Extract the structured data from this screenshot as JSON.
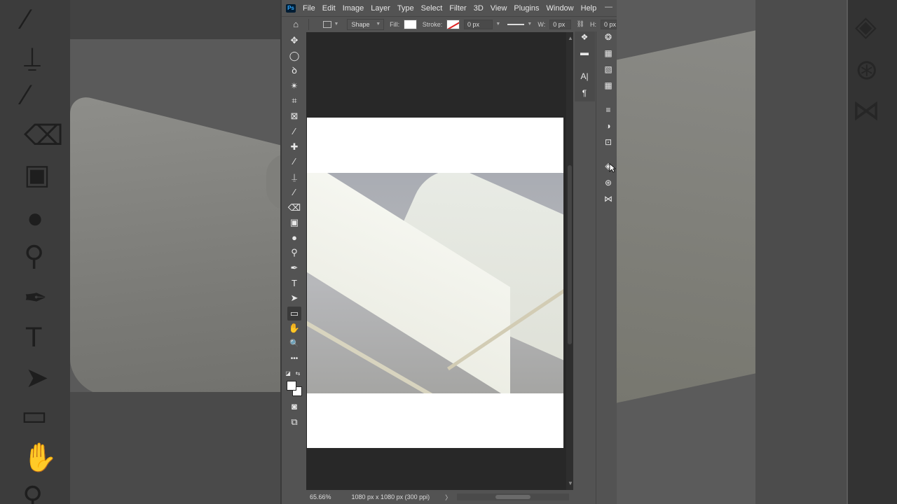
{
  "menubar": {
    "logo": "Ps",
    "items": [
      "File",
      "Edit",
      "Image",
      "Layer",
      "Type",
      "Select",
      "Filter",
      "3D",
      "View",
      "Plugins",
      "Window",
      "Help"
    ]
  },
  "options": {
    "mode": "Shape",
    "fill_label": "Fill:",
    "stroke_label": "Stroke:",
    "stroke_width": "0 px",
    "w_label": "W:",
    "w_value": "0 px",
    "h_label": "H:",
    "h_value": "0 px",
    "fill_color": "#ffffff"
  },
  "tools": [
    {
      "name": "move-tool",
      "glyph": "✥"
    },
    {
      "name": "elliptical-marquee-tool",
      "glyph": "◯"
    },
    {
      "name": "lasso-tool",
      "glyph": "ꝺ"
    },
    {
      "name": "magic-wand-tool",
      "glyph": "✴"
    },
    {
      "name": "crop-tool",
      "glyph": "⌗"
    },
    {
      "name": "frame-tool",
      "glyph": "⊠"
    },
    {
      "name": "eyedropper-tool",
      "glyph": "⁄"
    },
    {
      "name": "healing-brush-tool",
      "glyph": "✚"
    },
    {
      "name": "brush-tool",
      "glyph": "⁄"
    },
    {
      "name": "clone-stamp-tool",
      "glyph": "⍊"
    },
    {
      "name": "history-brush-tool",
      "glyph": "⁄"
    },
    {
      "name": "eraser-tool",
      "glyph": "⌫"
    },
    {
      "name": "gradient-tool",
      "glyph": "▣"
    },
    {
      "name": "blur-tool",
      "glyph": "●"
    },
    {
      "name": "dodge-tool",
      "glyph": "⚲"
    },
    {
      "name": "pen-tool",
      "glyph": "✒"
    },
    {
      "name": "type-tool",
      "glyph": "T"
    },
    {
      "name": "path-selection-tool",
      "glyph": "➤"
    },
    {
      "name": "rectangle-tool",
      "glyph": "▭"
    },
    {
      "name": "hand-tool",
      "glyph": "✋"
    },
    {
      "name": "zoom-tool",
      "glyph": "🔍"
    },
    {
      "name": "edit-toolbar",
      "glyph": "•••"
    }
  ],
  "tool_extras": [
    {
      "name": "quick-mask-icon",
      "glyph": "◙"
    },
    {
      "name": "screen-mode-icon",
      "glyph": "⧉"
    }
  ],
  "status": {
    "zoom": "65.66%",
    "doc_info": "1080 px x 1080 px (300 ppi)",
    "arrow": "〉"
  },
  "panels_left": [
    {
      "name": "learn-panel-icon",
      "glyph": "❖"
    },
    {
      "name": "comments-panel-icon",
      "glyph": "▬"
    },
    {
      "name": "character-panel-icon",
      "glyph": "A|"
    },
    {
      "name": "paragraph-panel-icon",
      "glyph": "¶"
    }
  ],
  "panels_right": [
    {
      "name": "color-panel-icon",
      "glyph": "❂"
    },
    {
      "name": "swatches-panel-icon",
      "glyph": "▦"
    },
    {
      "name": "gradients-panel-icon",
      "glyph": "▧"
    },
    {
      "name": "patterns-panel-icon",
      "glyph": "▦"
    },
    {
      "name": "properties-panel-icon",
      "glyph": "≡"
    },
    {
      "name": "adjustments-panel-icon",
      "glyph": "◑"
    },
    {
      "name": "libraries-panel-icon",
      "glyph": "⊡"
    },
    {
      "name": "layers-panel-icon",
      "glyph": "◈"
    },
    {
      "name": "channels-panel-icon",
      "glyph": "⊛"
    },
    {
      "name": "paths-panel-icon",
      "glyph": "⋈"
    }
  ],
  "colors": {
    "foreground": "#ffffff",
    "background": "#ffffff",
    "accent": "#31a8ff"
  }
}
